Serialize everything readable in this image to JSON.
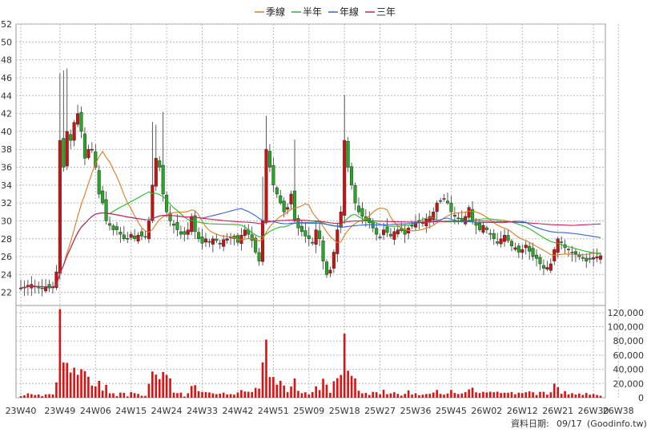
{
  "chart_data": {
    "type": "candlestick+line+bar",
    "legend": [
      {
        "name": "季線",
        "color": "#e07a1f"
      },
      {
        "name": "半年",
        "color": "#22bb22"
      },
      {
        "name": "年線",
        "color": "#3366dd"
      },
      {
        "name": "三年",
        "color": "#cc2255"
      }
    ],
    "price_axis": {
      "ylim": [
        20,
        52
      ],
      "ticks": [
        22,
        24,
        26,
        28,
        30,
        32,
        34,
        36,
        38,
        40,
        42,
        44,
        46,
        48,
        50,
        52
      ]
    },
    "volume_axis": {
      "ylim": [
        0,
        130000
      ],
      "ticks": [
        0,
        20000,
        40000,
        60000,
        80000,
        100000,
        120000
      ],
      "tick_labels": [
        "0",
        "20,000",
        "40,000",
        "60,000",
        "80,000",
        "100,000",
        "120,000"
      ]
    },
    "x_labels": [
      "23W40",
      "23W49",
      "24W06",
      "24W15",
      "24W24",
      "24W33",
      "24W42",
      "24W51",
      "25W09",
      "25W18",
      "25W27",
      "25W36",
      "25W45",
      "26W02",
      "26W12",
      "26W21",
      "26W30",
      "26W38"
    ],
    "x_label_index": [
      0,
      11,
      21,
      31,
      41,
      51,
      61,
      71,
      81,
      91,
      101,
      111,
      121,
      131,
      141,
      151,
      161,
      168
    ],
    "close": [
      22.5,
      22.6,
      22.8,
      22.9,
      22.7,
      22.5,
      22.5,
      22.6,
      22.5,
      22.6,
      24.3,
      39,
      36,
      40,
      39,
      41,
      42,
      40,
      37,
      38,
      38,
      36,
      33,
      32,
      30,
      29.5,
      29,
      29,
      28.5,
      28,
      28,
      28.5,
      28,
      28.4,
      28.3,
      28.2,
      30,
      34,
      37,
      36,
      33,
      31,
      30,
      29.5,
      29,
      28.5,
      28.5,
      29,
      30.5,
      28.8,
      28,
      27.5,
      28,
      27.6,
      28,
      27.8,
      27.5,
      27.9,
      28,
      28.2,
      28,
      27.6,
      28.4,
      29,
      28.5,
      27.8,
      26.5,
      25.5,
      30,
      38,
      36,
      34,
      33,
      32,
      31,
      31.5,
      33,
      30,
      29.2,
      28.8,
      28.3,
      28,
      27.5,
      29,
      28,
      25.5,
      24,
      24.5,
      26.5,
      29,
      31,
      39,
      36,
      34,
      32,
      31,
      30.5,
      30,
      29.8,
      29.2,
      28.5,
      28.2,
      29,
      28.7,
      28.3,
      28.8,
      29,
      28.9,
      28.5,
      29.2,
      29.5,
      29.8,
      30,
      29.8,
      30.2,
      30.5,
      31,
      32,
      32.2,
      32.5,
      32,
      31,
      30.5,
      30.3,
      30,
      30.5,
      31.5,
      30,
      29.5,
      29,
      29.5,
      29,
      28.5,
      28,
      27.5,
      28,
      28.4,
      27.8,
      27.2,
      27,
      26.5,
      26.8,
      27.3,
      26.6,
      26,
      25.8,
      25.2,
      24.7,
      24.8,
      25.2,
      26.8,
      28,
      27.6,
      27,
      26.8,
      26.5,
      26.3,
      26,
      25.8,
      25.5,
      25.7,
      25.9,
      26,
      26.1
    ]
  },
  "footer": {
    "label": "資料日期:",
    "date": "09/17",
    "source": "(Goodinfo.tw)"
  }
}
